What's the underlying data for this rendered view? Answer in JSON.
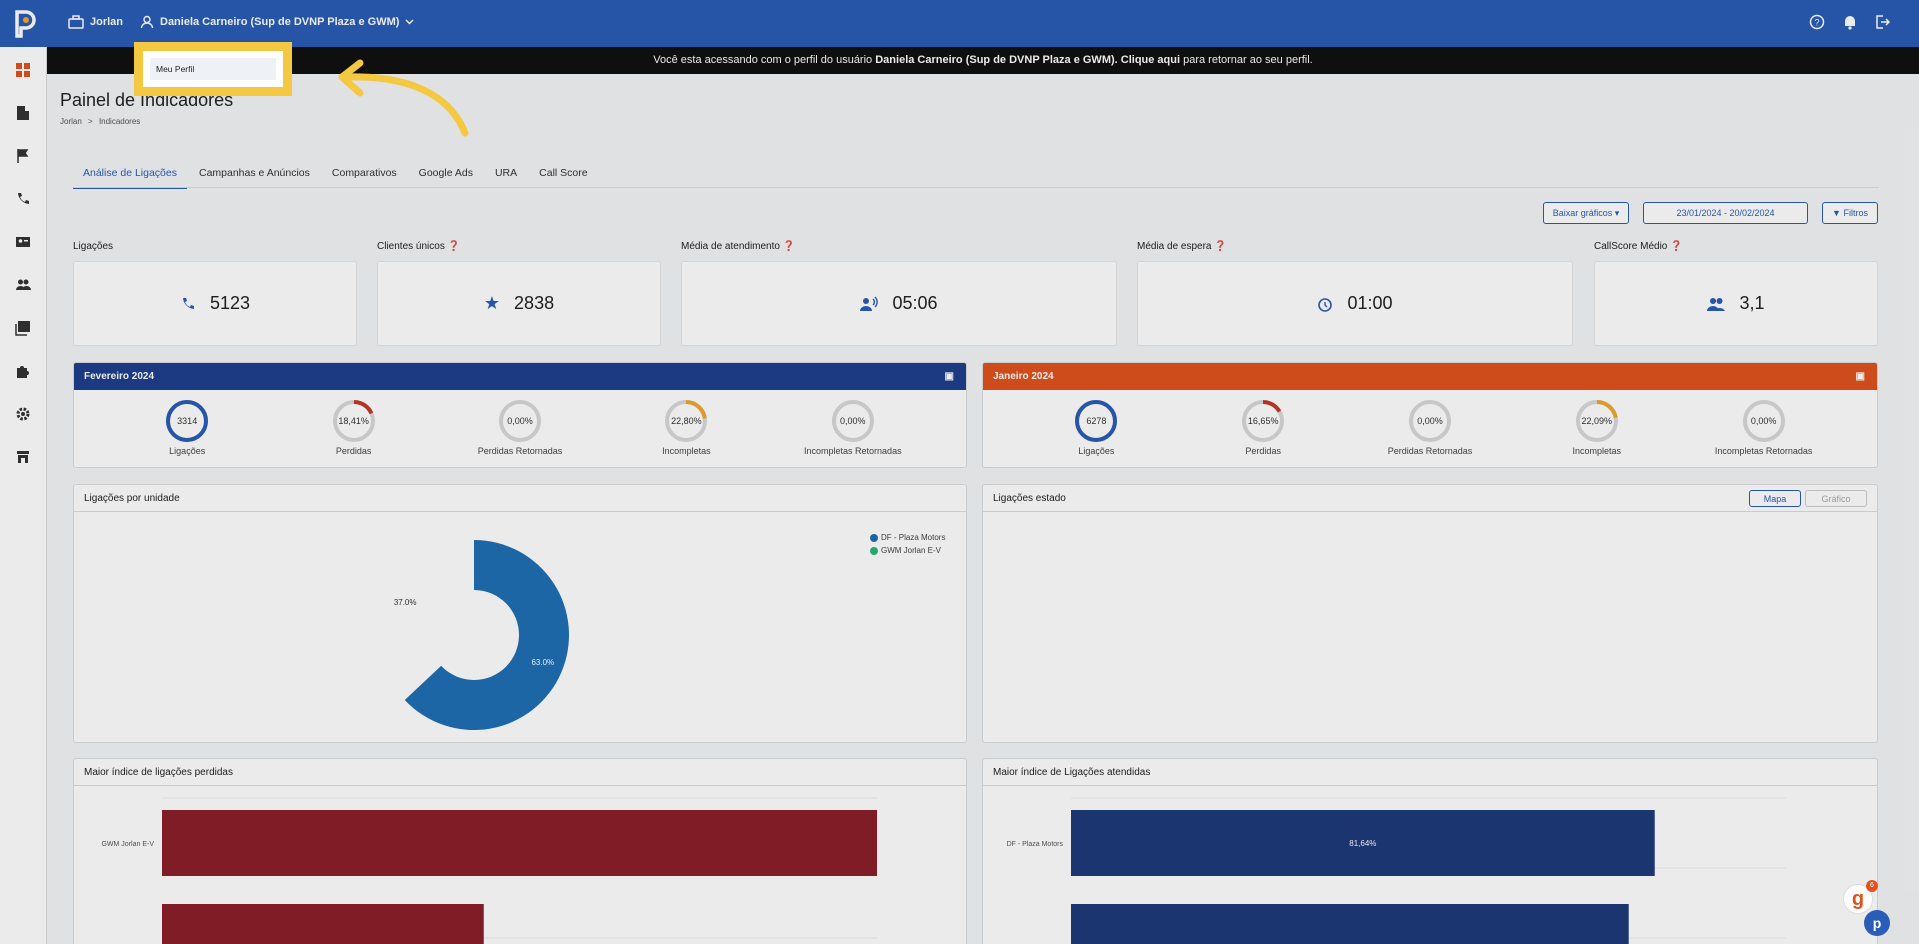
{
  "topbar": {
    "company": "Jorlan",
    "user": "Daniela Carneiro (Sup de DVNP Plaza e GWM)"
  },
  "dropdown": {
    "item": "Meu Perfil"
  },
  "banner": {
    "prefix": "Você esta acessando com o perfil do usuário",
    "user": "Daniela Carneiro (Sup de DVNP Plaza e GWM).",
    "link": "Clique aqui",
    "suffix": "para retornar ao seu perfil."
  },
  "page": {
    "title": "Painel de Indicadores",
    "breadcrumb": [
      "Jorlan",
      ">",
      "Indicadores"
    ]
  },
  "tabs": [
    "Análise de Ligações",
    "Campanhas e Anúncios",
    "Comparativos",
    "Google Ads",
    "URA",
    "Call Score"
  ],
  "toolbar": {
    "download_label": "Baixar gráficos",
    "date_range": "23/01/2024 - 20/02/2024",
    "filters_label": "Filtros"
  },
  "kpis": [
    {
      "label": "Ligações",
      "value": "5123",
      "icon": "phone-icon"
    },
    {
      "label": "Clientes únicos",
      "value": "2838",
      "icon": "star-icon"
    },
    {
      "label": "Média de atendimento",
      "value": "05:06",
      "icon": "voice-icon"
    },
    {
      "label": "Média de espera",
      "value": "01:00",
      "icon": "alarm-icon"
    },
    {
      "label": "CallScore Médio",
      "value": "3,1",
      "icon": "people-icon"
    }
  ],
  "periods": [
    {
      "title": "Fevereiro 2024",
      "color": "#1e3f8c",
      "gauges": [
        {
          "value": "3314",
          "label": "Ligações",
          "color": "#2a5db7",
          "fraction": 1.0
        },
        {
          "value": "18,41%",
          "label": "Perdidas",
          "color": "#c0392b",
          "fraction": 0.1841
        },
        {
          "value": "0,00%",
          "label": "Perdidas Retornadas",
          "color": "#c0392b",
          "fraction": 0.0
        },
        {
          "value": "22,80%",
          "label": "Incompletas",
          "color": "#f0a830",
          "fraction": 0.228
        },
        {
          "value": "0,00%",
          "label": "Incompletas Retornadas",
          "color": "#f0a830",
          "fraction": 0.0
        }
      ]
    },
    {
      "title": "Janeiro 2024",
      "color": "#e0531f",
      "gauges": [
        {
          "value": "6278",
          "label": "Ligações",
          "color": "#2a5db7",
          "fraction": 1.0
        },
        {
          "value": "16,65%",
          "label": "Perdidas",
          "color": "#c0392b",
          "fraction": 0.1665
        },
        {
          "value": "0,00%",
          "label": "Perdidas Retornadas",
          "color": "#c0392b",
          "fraction": 0.0
        },
        {
          "value": "22,09%",
          "label": "Incompletas",
          "color": "#f0a830",
          "fraction": 0.2209
        },
        {
          "value": "0,00%",
          "label": "Incompletas Retornadas",
          "color": "#f0a830",
          "fraction": 0.0
        }
      ]
    }
  ],
  "panels": {
    "by_unit": "Ligações por unidade",
    "by_state": "Ligações estado",
    "map_btn": "Mapa",
    "chart_btn": "Gráfico",
    "lost": "Maior índice de ligações perdidas",
    "answered": "Maior índice de Ligações atendidas"
  },
  "chart_data": [
    {
      "type": "pie",
      "title": "Ligações por unidade",
      "categories": [
        "DF - Plaza Motors",
        "GWM Jorlan E-V"
      ],
      "values": [
        63.0,
        37.0
      ],
      "labels": [
        "63.0%",
        "37.0%"
      ],
      "colors": [
        "#1f6fb5",
        "#2bb673"
      ]
    },
    {
      "type": "bar",
      "title": "Maior índice de ligações perdidas",
      "categories": [
        "GWM Jorlan E-V",
        ""
      ],
      "values": [
        100,
        45
      ],
      "colors": [
        "#8b1f2a"
      ]
    },
    {
      "type": "bar",
      "title": "Maior índice de Ligações atendidas",
      "categories": [
        "DF - Plaza Motors",
        ""
      ],
      "values": [
        81.64,
        78
      ],
      "labels": [
        "81,64%",
        ""
      ],
      "colors": [
        "#1e3a7a"
      ]
    }
  ]
}
